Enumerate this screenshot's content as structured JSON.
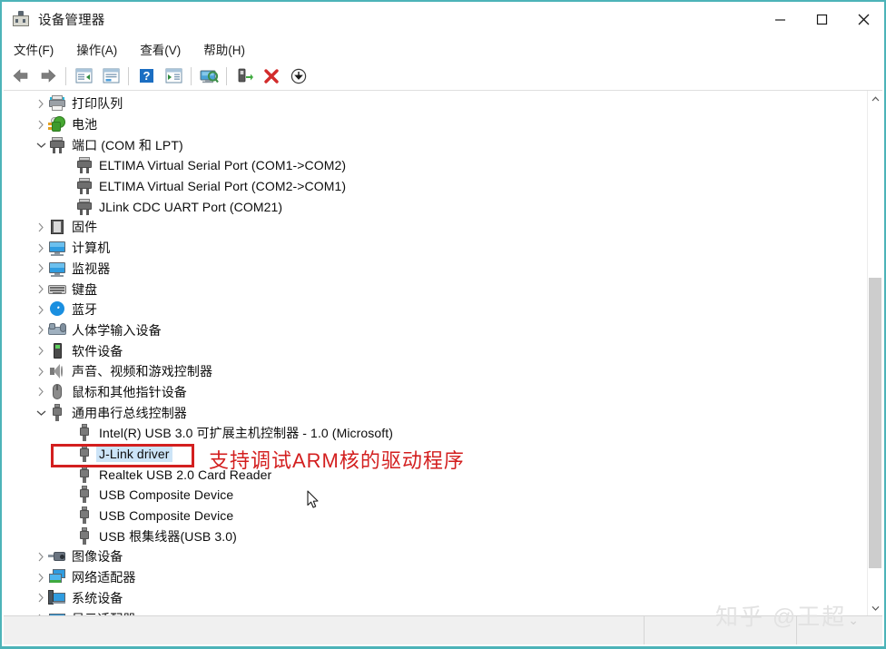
{
  "window": {
    "title": "设备管理器",
    "app_icon": "device-manager-icon",
    "accent_border": "#4cb3b8",
    "controls": {
      "minimize": "minimize-icon",
      "maximize": "maximize-icon",
      "close": "close-icon"
    }
  },
  "menubar": {
    "items": [
      {
        "label": "文件(F)",
        "name": "menu-file"
      },
      {
        "label": "操作(A)",
        "name": "menu-action"
      },
      {
        "label": "查看(V)",
        "name": "menu-view"
      },
      {
        "label": "帮助(H)",
        "name": "menu-help"
      }
    ]
  },
  "toolbar": {
    "buttons": [
      {
        "name": "back-icon",
        "title": "后退"
      },
      {
        "name": "forward-icon",
        "title": "前进"
      },
      {
        "name": "show-hide-console-tree-icon",
        "title": "显示/隐藏控制台树"
      },
      {
        "name": "properties-icon",
        "title": "属性"
      },
      {
        "name": "help-icon",
        "title": "帮助"
      },
      {
        "name": "show-hide-action-pane-icon",
        "title": "显示/隐藏操作窗格"
      },
      {
        "name": "scan-for-hardware-changes-icon",
        "title": "扫描检测硬件改动"
      },
      {
        "name": "update-driver-icon",
        "title": "更新驱动程序"
      },
      {
        "name": "uninstall-device-icon",
        "title": "卸载设备"
      },
      {
        "name": "disable-device-icon",
        "title": "禁用设备"
      }
    ]
  },
  "tree": {
    "rows": [
      {
        "label": "打印队列",
        "icon": "printer-icon",
        "level": 1,
        "twisty": "collapsed",
        "selected": false
      },
      {
        "label": "电池",
        "icon": "battery-icon",
        "level": 1,
        "twisty": "collapsed",
        "selected": false
      },
      {
        "label": "端口 (COM 和 LPT)",
        "icon": "serial-port-icon",
        "level": 1,
        "twisty": "expanded",
        "selected": false
      },
      {
        "label": "ELTIMA Virtual Serial Port (COM1->COM2)",
        "icon": "serial-port-icon",
        "level": 2,
        "twisty": "none",
        "selected": false
      },
      {
        "label": "ELTIMA Virtual Serial Port (COM2->COM1)",
        "icon": "serial-port-icon",
        "level": 2,
        "twisty": "none",
        "selected": false
      },
      {
        "label": "JLink CDC UART Port (COM21)",
        "icon": "serial-port-icon",
        "level": 2,
        "twisty": "none",
        "selected": false
      },
      {
        "label": "固件",
        "icon": "firmware-chip-icon",
        "level": 1,
        "twisty": "collapsed",
        "selected": false
      },
      {
        "label": "计算机",
        "icon": "computer-icon",
        "level": 1,
        "twisty": "collapsed",
        "selected": false
      },
      {
        "label": "监视器",
        "icon": "monitor-icon",
        "level": 1,
        "twisty": "collapsed",
        "selected": false
      },
      {
        "label": "键盘",
        "icon": "keyboard-icon",
        "level": 1,
        "twisty": "collapsed",
        "selected": false
      },
      {
        "label": "蓝牙",
        "icon": "bluetooth-icon",
        "level": 1,
        "twisty": "collapsed",
        "selected": false
      },
      {
        "label": "人体学输入设备",
        "icon": "hid-devices-icon",
        "level": 1,
        "twisty": "collapsed",
        "selected": false
      },
      {
        "label": "软件设备",
        "icon": "software-device-icon",
        "level": 1,
        "twisty": "collapsed",
        "selected": false
      },
      {
        "label": "声音、视频和游戏控制器",
        "icon": "speaker-icon",
        "level": 1,
        "twisty": "collapsed",
        "selected": false
      },
      {
        "label": "鼠标和其他指针设备",
        "icon": "mouse-icon",
        "level": 1,
        "twisty": "collapsed",
        "selected": false
      },
      {
        "label": "通用串行总线控制器",
        "icon": "usb-icon",
        "level": 1,
        "twisty": "expanded",
        "selected": false
      },
      {
        "label": "Intel(R) USB 3.0 可扩展主机控制器 - 1.0 (Microsoft)",
        "icon": "usb-icon",
        "level": 2,
        "twisty": "none",
        "selected": false
      },
      {
        "label": "J-Link driver",
        "icon": "usb-icon",
        "level": 2,
        "twisty": "none",
        "selected": true
      },
      {
        "label": "Realtek USB 2.0 Card Reader",
        "icon": "usb-icon",
        "level": 2,
        "twisty": "none",
        "selected": false
      },
      {
        "label": "USB Composite Device",
        "icon": "usb-icon",
        "level": 2,
        "twisty": "none",
        "selected": false
      },
      {
        "label": "USB Composite Device",
        "icon": "usb-icon",
        "level": 2,
        "twisty": "none",
        "selected": false
      },
      {
        "label": "USB 根集线器(USB 3.0)",
        "icon": "usb-icon",
        "level": 2,
        "twisty": "none",
        "selected": false
      },
      {
        "label": "图像设备",
        "icon": "imaging-device-icon",
        "level": 1,
        "twisty": "collapsed",
        "selected": false
      },
      {
        "label": "网络适配器",
        "icon": "network-adapter-icon",
        "level": 1,
        "twisty": "collapsed",
        "selected": false
      },
      {
        "label": "系统设备",
        "icon": "system-device-icon",
        "level": 1,
        "twisty": "collapsed",
        "selected": false
      },
      {
        "label": "显示适配器",
        "icon": "display-adapter-icon",
        "level": 1,
        "twisty": "collapsed",
        "selected": false
      }
    ]
  },
  "annotation": {
    "text": "支持调试ARM核的驱动程序",
    "color": "#d31f1f",
    "highlight_target": "J-Link driver"
  },
  "scrollbar": {
    "up_arrow": "chevron-up-icon",
    "down_arrow": "chevron-down-icon"
  },
  "watermark": {
    "text": "知乎 @王超",
    "caret": "⌄"
  }
}
